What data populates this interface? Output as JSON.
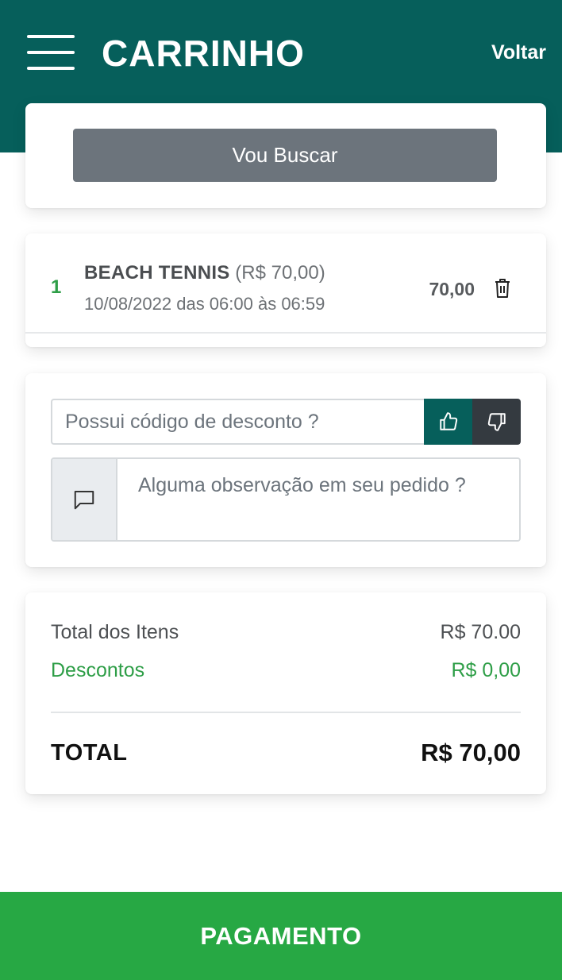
{
  "header": {
    "title": "CARRINHO",
    "back_label": "Voltar"
  },
  "pickup": {
    "button_label": "Vou Buscar"
  },
  "cart": {
    "items": [
      {
        "quantity": "1",
        "name": "BEACH TENNIS",
        "unit_price": "(R$ 70,00)",
        "schedule": "10/08/2022 das 06:00 às 06:59",
        "price": "70,00"
      }
    ]
  },
  "coupon": {
    "placeholder": "Possui código de desconto ?",
    "like_icon": "thumbs-up-icon",
    "dislike_icon": "thumbs-down-icon"
  },
  "note": {
    "placeholder": "Alguma observação em seu pedido ?",
    "icon": "message-square-icon"
  },
  "summary": {
    "items_label": "Total dos Itens",
    "items_value": "R$ 70.00",
    "discount_label": "Descontos",
    "discount_value": "R$ 0,00",
    "total_label": "TOTAL",
    "total_value": "R$ 70,00"
  },
  "payment": {
    "button_label": "PAGAMENTO"
  },
  "colors": {
    "header_bg": "#065f5b",
    "pay_bg": "#27a844",
    "discount": "#2e9e47",
    "pickup_bg": "#6c747c",
    "dislike_bg": "#343a40"
  }
}
